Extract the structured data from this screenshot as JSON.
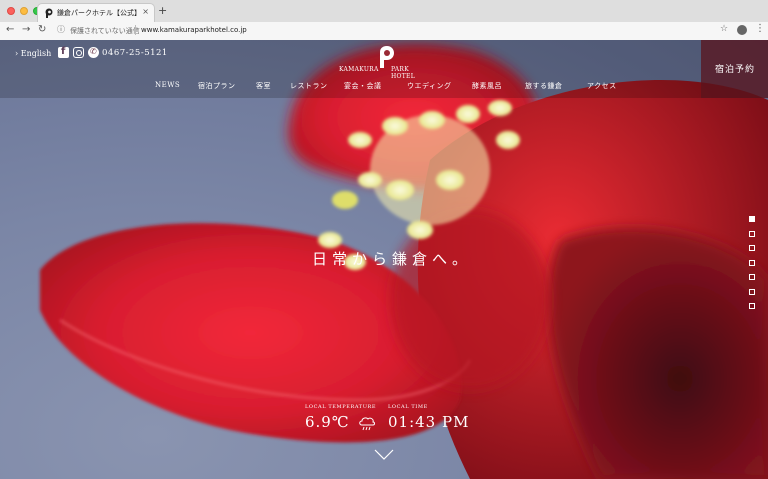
{
  "browser": {
    "tab_title": "鎌倉パークホテル【公式】| KA",
    "tab_close": "×",
    "new_tab": "+",
    "security_label": "保護されていない通信",
    "url": "www.kamakuraparkhotel.co.jp"
  },
  "header": {
    "english_link": "› English",
    "phone": "0467-25-5121",
    "logo_left": "KAMAKURA",
    "logo_right": "PARK HOTEL",
    "reserve": "宿泊予約"
  },
  "menu": [
    {
      "label": "NEWS"
    },
    {
      "label": "宿泊プラン"
    },
    {
      "label": "客室"
    },
    {
      "label": "レストラン"
    },
    {
      "label": "宴会・会議"
    },
    {
      "label": "ウエディング"
    },
    {
      "label": "酵素風呂"
    },
    {
      "label": "旅する鎌倉"
    },
    {
      "label": "アクセス"
    }
  ],
  "hero": {
    "tagline": "日常から鎌倉へ。",
    "slides": 7,
    "active_slide": 1
  },
  "info": {
    "temperature_label": "LOCAL TEMPERATURE",
    "temperature": "6.9℃",
    "weather_icon": "cloud-rain-icon",
    "time_label": "LOCAL TIME",
    "time": "01:43 PM"
  },
  "colors": {
    "accent": "#e0262e",
    "reserve_bg": "#6b1e2a"
  }
}
